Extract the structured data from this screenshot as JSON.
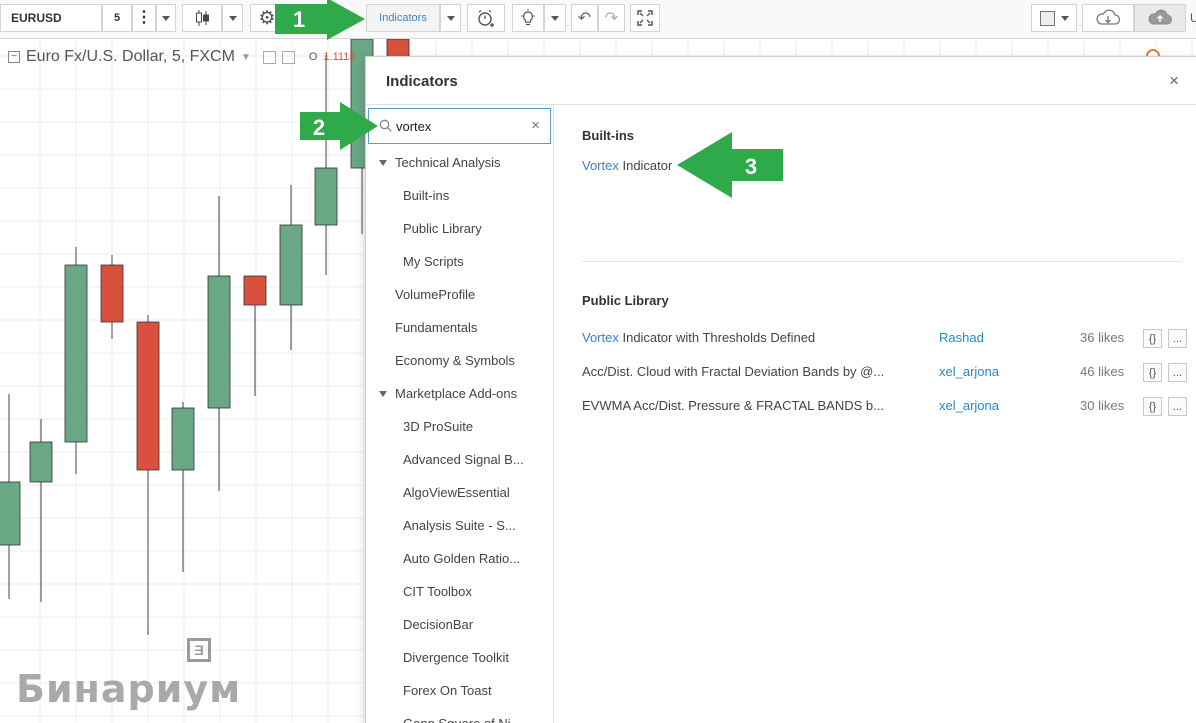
{
  "toolbar": {
    "symbol": "EURUSD",
    "interval": "5",
    "indicators_label": "Indicators",
    "partial_right_label": "U"
  },
  "chart": {
    "legend_title": "Euro Fx/U.S. Dollar, 5, FXCM",
    "ohlc_open_label": "O",
    "ohlc_open_value": "1.1113",
    "watermark": "Бинариум",
    "colors": {
      "up": "#6aa784",
      "down": "#d9503f",
      "grid": "#ececec"
    }
  },
  "dialog": {
    "title": "Indicators",
    "close_label": "×",
    "search": {
      "value": "vortex",
      "clear_label": "×"
    },
    "tree": [
      {
        "label": "Technical Analysis",
        "expandable": true
      },
      {
        "label": "Built-ins",
        "sub": true
      },
      {
        "label": "Public Library",
        "sub": true
      },
      {
        "label": "My Scripts",
        "sub": true
      },
      {
        "label": "VolumeProfile"
      },
      {
        "label": "Fundamentals"
      },
      {
        "label": "Economy & Symbols"
      },
      {
        "label": "Marketplace Add-ons",
        "expandable": true
      },
      {
        "label": "3D ProSuite",
        "sub": true
      },
      {
        "label": "Advanced Signal B...",
        "sub": true
      },
      {
        "label": "AlgoViewEssential",
        "sub": true
      },
      {
        "label": "Analysis Suite - S...",
        "sub": true
      },
      {
        "label": "Auto Golden Ratio...",
        "sub": true
      },
      {
        "label": "CIT Toolbox",
        "sub": true
      },
      {
        "label": "DecisionBar",
        "sub": true
      },
      {
        "label": "Divergence Toolkit",
        "sub": true
      },
      {
        "label": "Forex On Toast",
        "sub": true
      },
      {
        "label": "Gann Square of Ni...",
        "sub": true
      }
    ],
    "builtins": {
      "title": "Built-ins",
      "items": [
        {
          "highlight": "Vortex",
          "rest": " Indicator"
        }
      ]
    },
    "public_library": {
      "title": "Public Library",
      "items": [
        {
          "highlight": "Vortex",
          "rest": " Indicator with Thresholds Defined",
          "author": "Rashad",
          "likes": "36 likes",
          "code_label": "{}",
          "more_label": "..."
        },
        {
          "highlight": "",
          "rest": "Acc/Dist. Cloud with Fractal Deviation Bands by @...",
          "author": "xel_arjona",
          "likes": "46 likes",
          "code_label": "{}",
          "more_label": "..."
        },
        {
          "highlight": "",
          "rest": "EVWMA Acc/Dist. Pressure & FRACTAL BANDS b...",
          "author": "xel_arjona",
          "likes": "30 likes",
          "code_label": "{}",
          "more_label": "..."
        }
      ]
    }
  },
  "annotations": [
    {
      "label": "1",
      "color": "#2eaa4a"
    },
    {
      "label": "2",
      "color": "#2eaa4a"
    },
    {
      "label": "3",
      "color": "#2eaa4a"
    }
  ]
}
